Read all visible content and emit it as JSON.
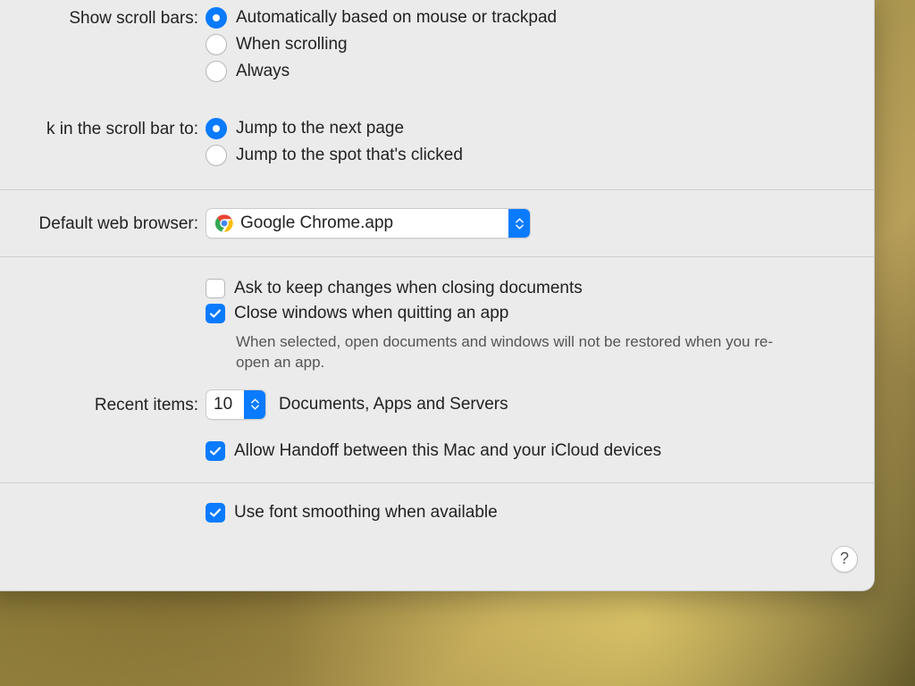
{
  "scrollBars": {
    "label": "Show scroll bars:",
    "options": [
      "Automatically based on mouse or trackpad",
      "When scrolling",
      "Always"
    ],
    "selectedIndex": 0
  },
  "scrollClick": {
    "label": "k in the scroll bar to:",
    "options": [
      "Jump to the next page",
      "Jump to the spot that's clicked"
    ],
    "selectedIndex": 0
  },
  "defaultBrowser": {
    "label": "Default web browser:",
    "value": "Google Chrome.app"
  },
  "docs": {
    "askChanges": {
      "label": "Ask to keep changes when closing documents",
      "checked": false
    },
    "closeWindows": {
      "label": "Close windows when quitting an app",
      "checked": true
    },
    "closeWindowsNote": "When selected, open documents and windows will not be restored when you re-open an app."
  },
  "recentItems": {
    "label": "Recent items:",
    "value": "10",
    "suffix": "Documents, Apps and Servers"
  },
  "handoff": {
    "label": "Allow Handoff between this Mac and your iCloud devices",
    "checked": true
  },
  "fontSmoothing": {
    "label": "Use font smoothing when available",
    "checked": true
  },
  "help": "?"
}
